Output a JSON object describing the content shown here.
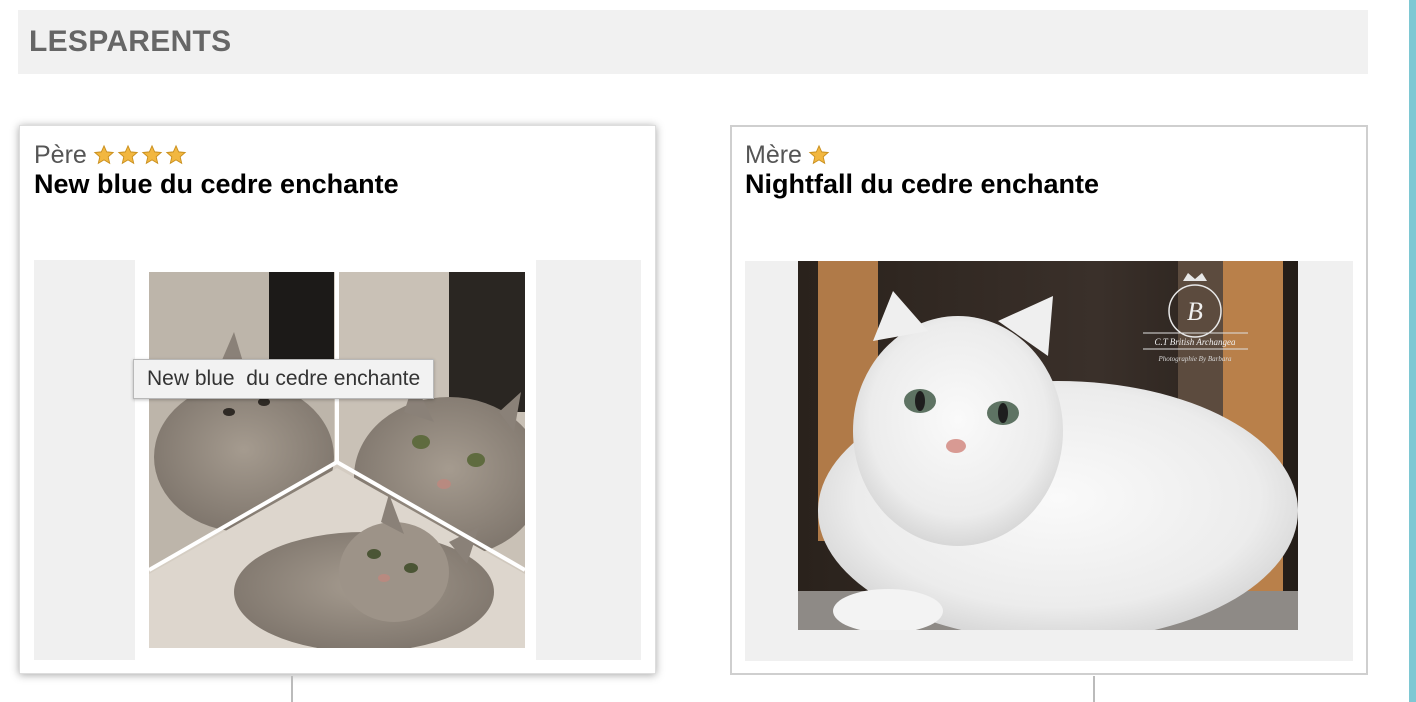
{
  "section": {
    "title": "LESPARENTS"
  },
  "father": {
    "role": "Père",
    "stars": 4,
    "name": "New blue du cedre enchante",
    "photo_alt": "New blue  du cedre enchante"
  },
  "mother": {
    "role": "Mère",
    "stars": 1,
    "name": "Nightfall du cedre enchante",
    "photo_alt": "Nightfall du cedre enchante"
  },
  "tooltip": {
    "text": "New blue  du cedre enchante"
  },
  "watermark": {
    "line1": "C.T British Archangea",
    "line2": "Photographie By Barbara"
  },
  "colors": {
    "accent": "#7ec8d3",
    "star": "#f2b740",
    "header_bg": "#f1f1f1",
    "title": "#666666"
  },
  "icons": {
    "rating": "star-icon"
  }
}
